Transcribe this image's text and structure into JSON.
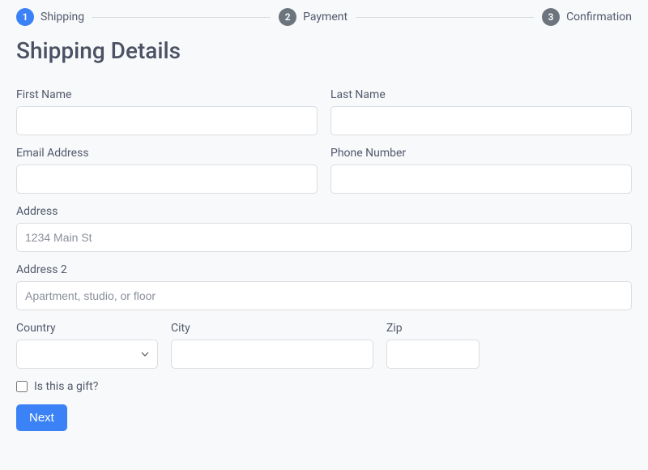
{
  "stepper": {
    "steps": [
      {
        "num": "1",
        "label": "Shipping",
        "active": true
      },
      {
        "num": "2",
        "label": "Payment",
        "active": false
      },
      {
        "num": "3",
        "label": "Confirmation",
        "active": false
      }
    ]
  },
  "page": {
    "title": "Shipping Details"
  },
  "form": {
    "first_name": {
      "label": "First Name",
      "value": ""
    },
    "last_name": {
      "label": "Last Name",
      "value": ""
    },
    "email": {
      "label": "Email Address",
      "value": ""
    },
    "phone": {
      "label": "Phone Number",
      "value": ""
    },
    "address": {
      "label": "Address",
      "placeholder": "1234 Main St",
      "value": ""
    },
    "address2": {
      "label": "Address 2",
      "placeholder": "Apartment, studio, or floor",
      "value": ""
    },
    "country": {
      "label": "Country",
      "selected": ""
    },
    "city": {
      "label": "City",
      "value": ""
    },
    "zip": {
      "label": "Zip",
      "value": ""
    },
    "gift": {
      "label": "Is this a gift?",
      "checked": false
    }
  },
  "actions": {
    "next": "Next"
  }
}
